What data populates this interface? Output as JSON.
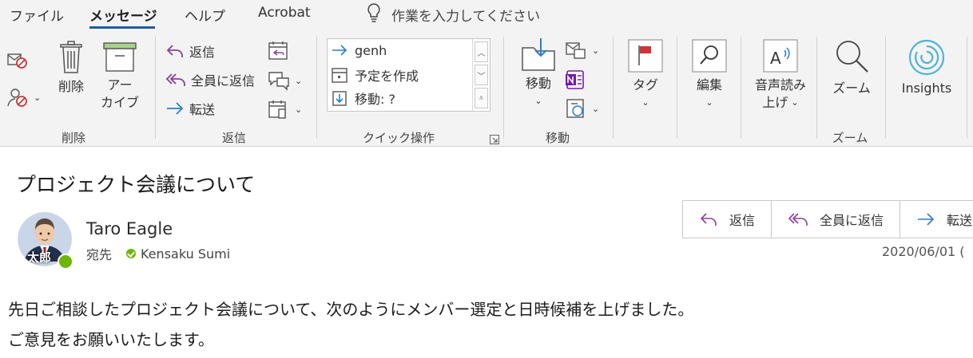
{
  "tabs": [
    {
      "label": "ファイル"
    },
    {
      "label": "メッセージ"
    },
    {
      "label": "ヘルプ"
    },
    {
      "label": "Acrobat"
    }
  ],
  "tell_me": {
    "label": "作業を入力してください",
    "icon": "lightbulb-icon"
  },
  "ribbon": {
    "delete_group": {
      "label": "削除",
      "delete": "削除",
      "archive_line1": "アー",
      "archive_line2": "カイブ"
    },
    "respond_group": {
      "label": "返信",
      "reply": "返信",
      "reply_all": "全員に返信",
      "forward": "転送"
    },
    "quick_steps": {
      "label": "クイック操作",
      "items": [
        {
          "label": "genh"
        },
        {
          "label": "予定を作成"
        },
        {
          "label": "移動: ?"
        }
      ]
    },
    "move_group": {
      "label": "移動",
      "move": "移動"
    },
    "tags": {
      "label": "タグ"
    },
    "editing": {
      "label": "編集"
    },
    "speech": {
      "line1": "音声読み",
      "line2": "上げ"
    },
    "zoom_group": {
      "label": "ズーム",
      "zoom": "ズーム"
    },
    "insights": {
      "label": "Insights"
    }
  },
  "message": {
    "subject": "プロジェクト会議について",
    "avatar_text": "太郎",
    "sender": "Taro Eagle",
    "to_label": "宛先",
    "recipient": "Kensaku Sumi",
    "date": "2020/06/01 (",
    "actions": {
      "reply": "返信",
      "reply_all": "全員に返信",
      "forward": "転送"
    },
    "body": [
      "先日ご相談したプロジェクト会議について、次のようにメンバー選定と日時候補を上げました。",
      "ご意見をお願いいたします。"
    ]
  },
  "colors": {
    "accent": "#1e5aa8",
    "reply_icon": "#8b3f9c",
    "forward_icon": "#2b7cd3",
    "presence": "#6bb700",
    "flag": "#d13438",
    "insights": "#4fb3d8",
    "ribbon_bg": "#f3f3f3"
  }
}
